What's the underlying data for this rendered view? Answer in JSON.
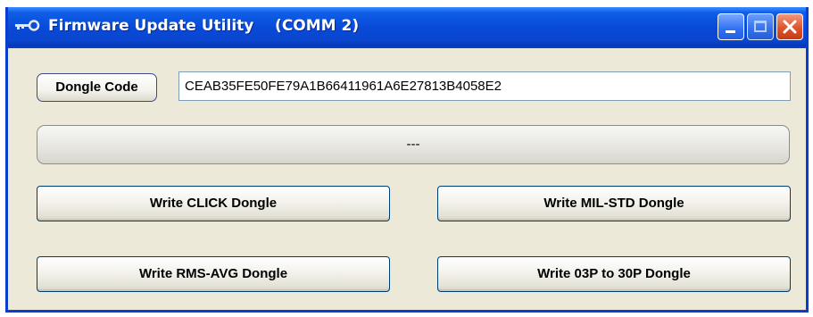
{
  "window": {
    "title": "Firmware Update Utility",
    "port": "(COMM 2)",
    "icon": "key-icon",
    "controls": {
      "minimize": "minimize-icon",
      "maximize": "maximize-icon",
      "close": "close-icon"
    }
  },
  "dongle": {
    "label": "Dongle Code",
    "code_value": "CEAB35FE50FE79A1B66411961A6E27813B4058E2"
  },
  "status": {
    "text": "---"
  },
  "buttons": {
    "write_click": "Write CLICK Dongle",
    "write_milstd": "Write MIL-STD Dongle",
    "write_rmsavg": "Write RMS-AVG Dongle",
    "write_03p30p": "Write 03P to 30P Dongle"
  },
  "colors": {
    "titlebar": "#0a46cf",
    "window_face": "#ece9d8",
    "close_button": "#e0532c",
    "button_border": "#003c74"
  }
}
